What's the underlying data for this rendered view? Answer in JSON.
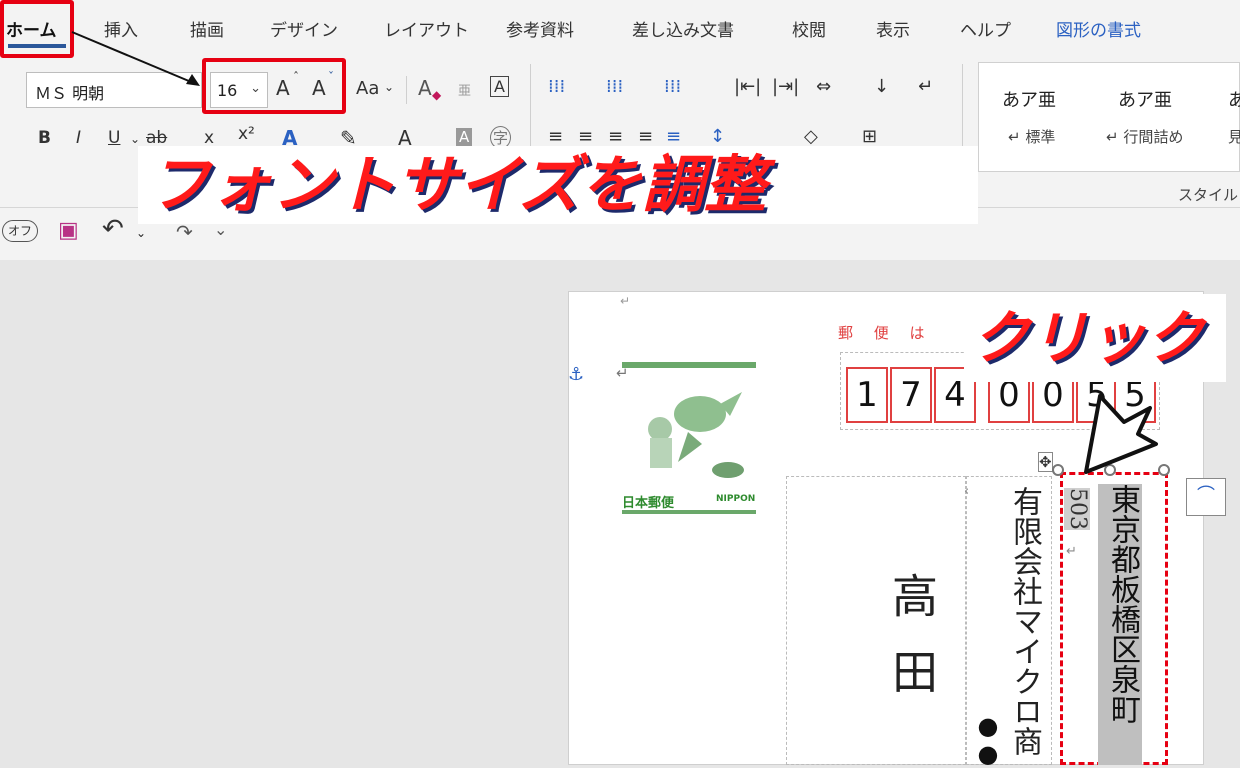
{
  "ribbon": {
    "tabs": [
      {
        "id": "home",
        "label": "ホーム"
      },
      {
        "id": "insert",
        "label": "挿入"
      },
      {
        "id": "draw",
        "label": "描画"
      },
      {
        "id": "design",
        "label": "デザイン"
      },
      {
        "id": "layout",
        "label": "レイアウト"
      },
      {
        "id": "references",
        "label": "参考資料"
      },
      {
        "id": "mailings",
        "label": "差し込み文書"
      },
      {
        "id": "review",
        "label": "校閲"
      },
      {
        "id": "view",
        "label": "表示"
      },
      {
        "id": "help",
        "label": "ヘルプ"
      },
      {
        "id": "shape_format",
        "label": "図形の書式"
      }
    ],
    "font": {
      "name": "ＭＳ 明朝",
      "size": "16",
      "grow_label": "A",
      "shrink_label": "A",
      "case_label": "Aa",
      "clear_label": "A",
      "phonetic_label": "亜",
      "border_label": "A",
      "bold": "B",
      "italic": "I",
      "underline": "U",
      "strike": "ab",
      "subscript": "x",
      "superscript": "x²",
      "effects": "A",
      "color_label": "A",
      "shade_label": "A",
      "enclose_label": "字"
    },
    "styles": {
      "group_label": "スタイル",
      "items": [
        {
          "sample": "あア亜",
          "name": "↵ 標準"
        },
        {
          "sample": "あア亜",
          "name": "↵ 行間詰め"
        },
        {
          "sample": "あ",
          "name": "見"
        }
      ]
    }
  },
  "qat": {
    "autosave_label": "オフ"
  },
  "document": {
    "postcard_header": "郵 便 は",
    "zip_digits": [
      "1",
      "7",
      "4",
      "0",
      "0",
      "5",
      "5"
    ],
    "stamp_left": "日本郵便",
    "stamp_right": "NIPPON",
    "address_line": "東京都板橋区泉町",
    "address_number": "503",
    "company": "有限会社マイクロ商",
    "recipient_name": "高田",
    "dots": "●●"
  },
  "annotations": {
    "caption_font": "フォントサイズを調整",
    "caption_click": "クリック"
  },
  "colors": {
    "accent": "#2b579a",
    "highlight_red": "#e60012",
    "zip_red": "#e04040",
    "stamp_green": "#6aa86a"
  }
}
